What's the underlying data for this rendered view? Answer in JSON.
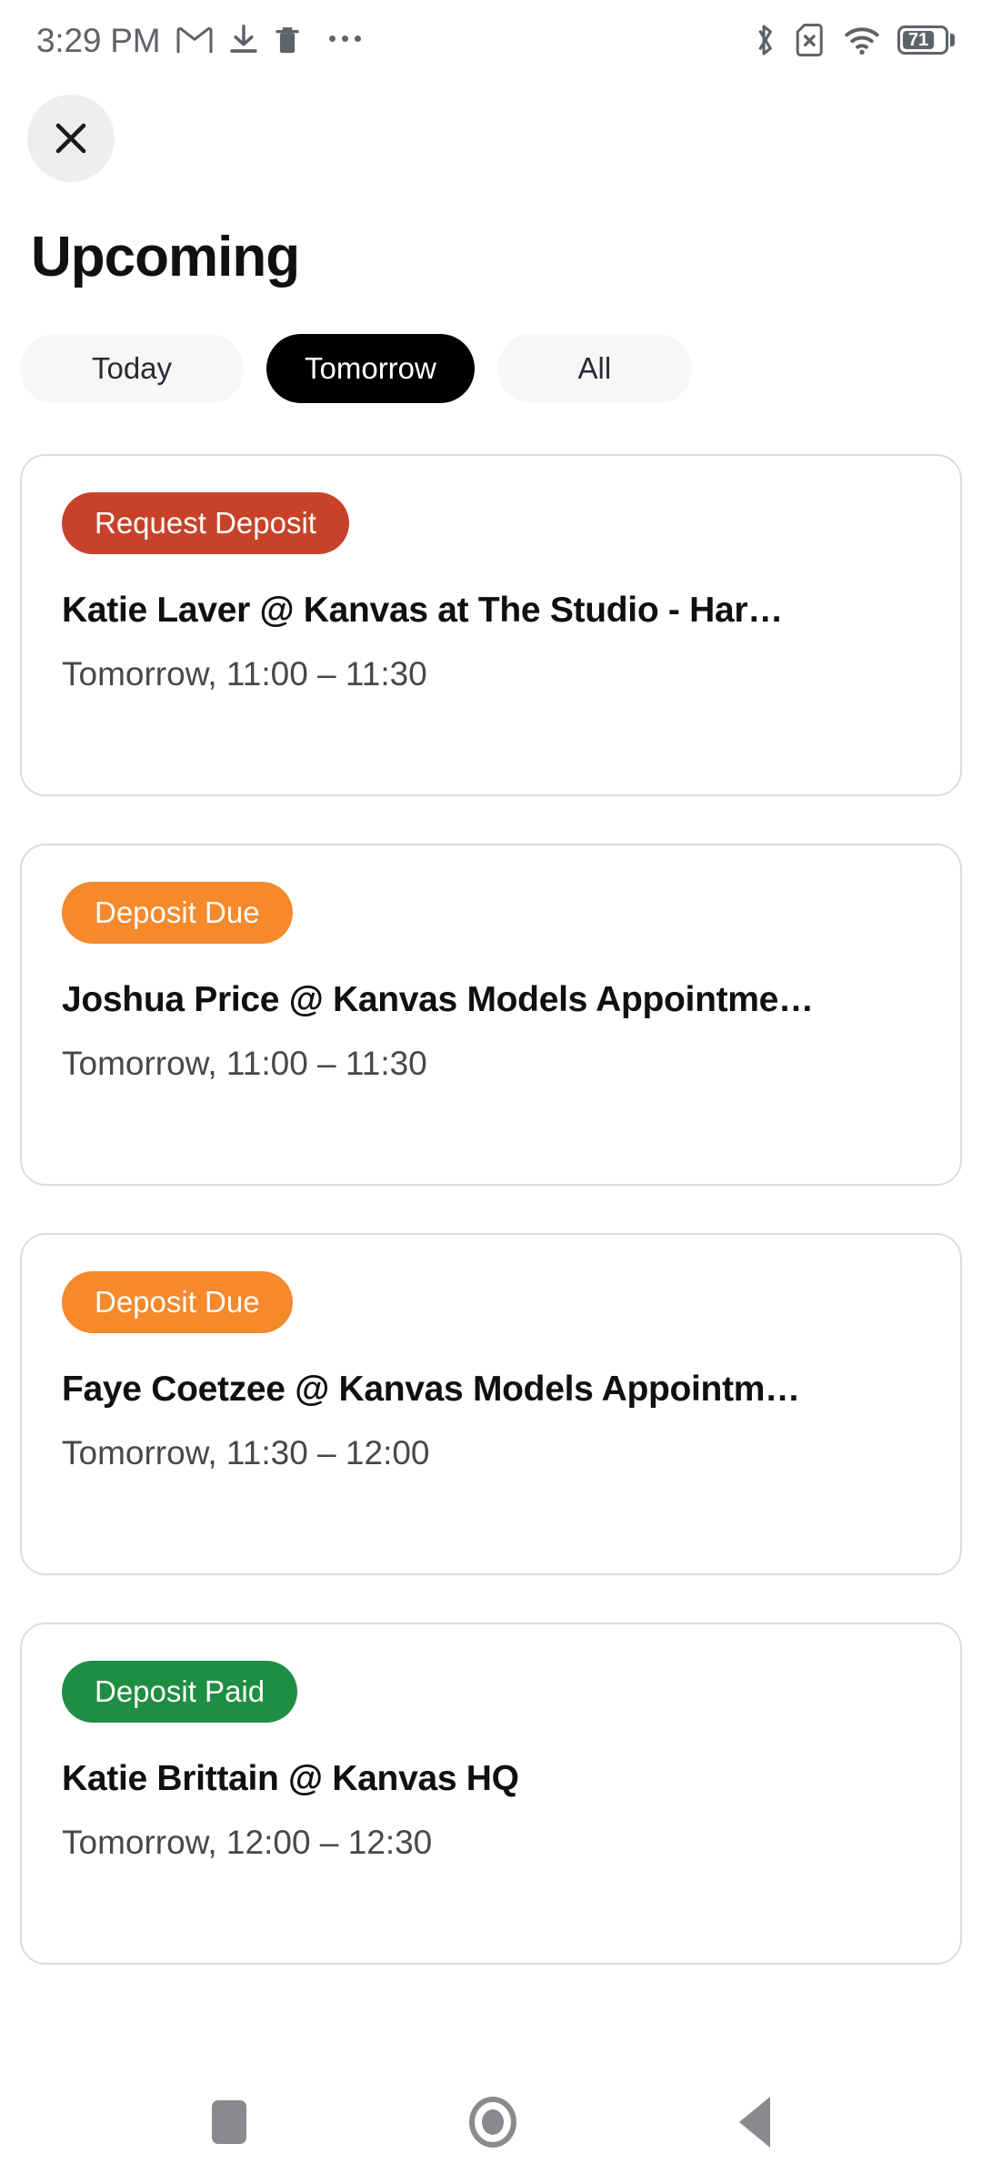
{
  "statusbar": {
    "clock": "3:29 PM",
    "left_icons": [
      "gmail-icon",
      "download-icon",
      "trash-icon",
      "overflow-dots-icon"
    ],
    "right_icons": [
      "bluetooth-icon",
      "sim-missing-icon",
      "wifi-icon",
      "battery-icon"
    ],
    "battery_level": "71"
  },
  "header": {
    "close_icon": "close-icon",
    "title": "Upcoming"
  },
  "filters": {
    "items": [
      {
        "label": "Today",
        "active": false
      },
      {
        "label": "Tomorrow",
        "active": true
      },
      {
        "label": "All",
        "active": false
      }
    ]
  },
  "colors": {
    "request_deposit": "#c8422a",
    "deposit_due": "#f6892c",
    "deposit_paid": "#1e8e42",
    "chip_active_bg": "#000000",
    "chip_inactive_bg": "#f7f6f9",
    "card_border": "#dcdcdf",
    "title_text": "#101013",
    "time_text": "#48484c"
  },
  "appointments": [
    {
      "badge": "Request Deposit",
      "badge_color": "#c8422a",
      "title": "Katie   Laver @ Kanvas at The Studio - Har…",
      "time": "Tomorrow, 11:00 –  11:30"
    },
    {
      "badge": "Deposit Due",
      "badge_color": "#f6892c",
      "title": "Joshua Price @ Kanvas Models Appointme…",
      "time": "Tomorrow, 11:00 –  11:30"
    },
    {
      "badge": "Deposit Due",
      "badge_color": "#f6892c",
      "title": "Faye  Coetzee @ Kanvas Models Appointm…",
      "time": "Tomorrow, 11:30 –  12:00"
    },
    {
      "badge": "Deposit Paid",
      "badge_color": "#1e8e42",
      "title": "Katie Brittain @ Kanvas HQ",
      "time": "Tomorrow, 12:00 –  12:30"
    }
  ],
  "navbar": {
    "recents_icon": "square-recents-icon",
    "home_icon": "circle-home-icon",
    "back_icon": "triangle-back-icon"
  }
}
